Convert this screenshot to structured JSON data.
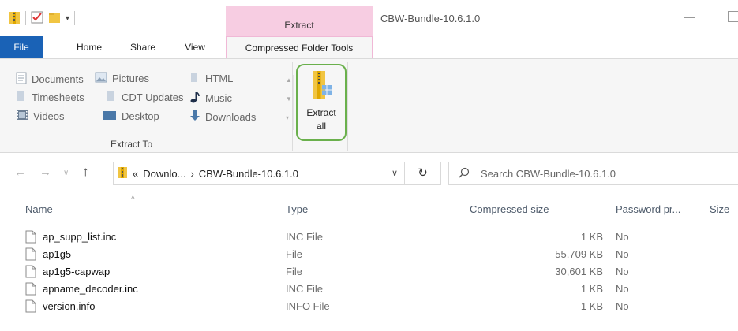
{
  "window": {
    "title": "CBW-Bundle-10.6.1.0",
    "context_tab_header": "Extract"
  },
  "ribbon_tabs": [
    {
      "label": "File"
    },
    {
      "label": "Home"
    },
    {
      "label": "Share"
    },
    {
      "label": "View"
    },
    {
      "label": "Compressed Folder Tools"
    }
  ],
  "extract_to": {
    "group_label": "Extract To",
    "destinations": [
      {
        "label": "Documents",
        "icon": "documents-icon"
      },
      {
        "label": "Pictures",
        "icon": "pictures-icon"
      },
      {
        "label": "HTML",
        "icon": "folder-icon"
      },
      {
        "label": "Timesheets",
        "icon": "folder-icon"
      },
      {
        "label": "CDT Updates",
        "icon": "folder-icon"
      },
      {
        "label": "Music",
        "icon": "music-icon"
      },
      {
        "label": "Videos",
        "icon": "videos-icon"
      },
      {
        "label": "Desktop",
        "icon": "desktop-icon"
      },
      {
        "label": "Downloads",
        "icon": "downloads-icon"
      }
    ]
  },
  "extract_all": {
    "label_line1": "Extract",
    "label_line2": "all"
  },
  "address_bar": {
    "overflow": "«",
    "crumbs": [
      "Downlo...",
      "CBW-Bundle-10.6.1.0"
    ],
    "separator": "›"
  },
  "search": {
    "placeholder": "Search CBW-Bundle-10.6.1.0"
  },
  "columns": [
    "Name",
    "Type",
    "Compressed size",
    "Password pr...",
    "Size"
  ],
  "files": [
    {
      "name": "ap_supp_list.inc",
      "type": "INC File",
      "compressed_size": "1 KB",
      "password": "No"
    },
    {
      "name": "ap1g5",
      "type": "File",
      "compressed_size": "55,709 KB",
      "password": "No"
    },
    {
      "name": "ap1g5-capwap",
      "type": "File",
      "compressed_size": "30,601 KB",
      "password": "No"
    },
    {
      "name": "apname_decoder.inc",
      "type": "INC File",
      "compressed_size": "1 KB",
      "password": "No"
    },
    {
      "name": "version.info",
      "type": "INFO File",
      "compressed_size": "1 KB",
      "password": "No"
    }
  ],
  "colors": {
    "file_tab": "#1a62b6",
    "context_tab": "#f7cde2",
    "highlight_outline": "#6ab04c",
    "folder": "#f1c542"
  }
}
